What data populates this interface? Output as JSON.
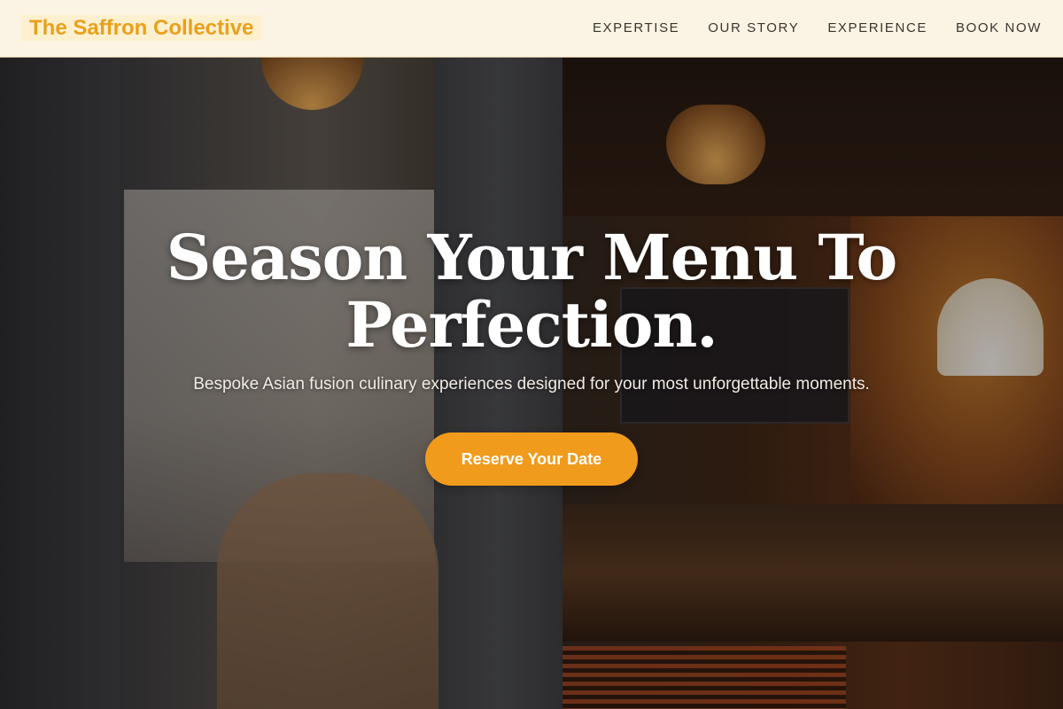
{
  "brand": {
    "name": "The Saffron Collective"
  },
  "nav": {
    "items": [
      {
        "label": "EXPERTISE"
      },
      {
        "label": "OUR STORY"
      },
      {
        "label": "EXPERIENCE"
      },
      {
        "label": "BOOK NOW"
      }
    ]
  },
  "hero": {
    "title": "Season Your Menu To Perfection.",
    "subtitle": "Bespoke Asian fusion culinary experiences designed for your most unforgettable moments.",
    "cta_label": "Reserve Your Date",
    "background_description_icon": "restaurant-interior-photo"
  },
  "colors": {
    "accent": "#f19b1c",
    "logo_text": "#e9a01b",
    "header_bg": "#fbf4e4",
    "nav_text": "#3a3430",
    "hero_text": "#ffffff"
  }
}
